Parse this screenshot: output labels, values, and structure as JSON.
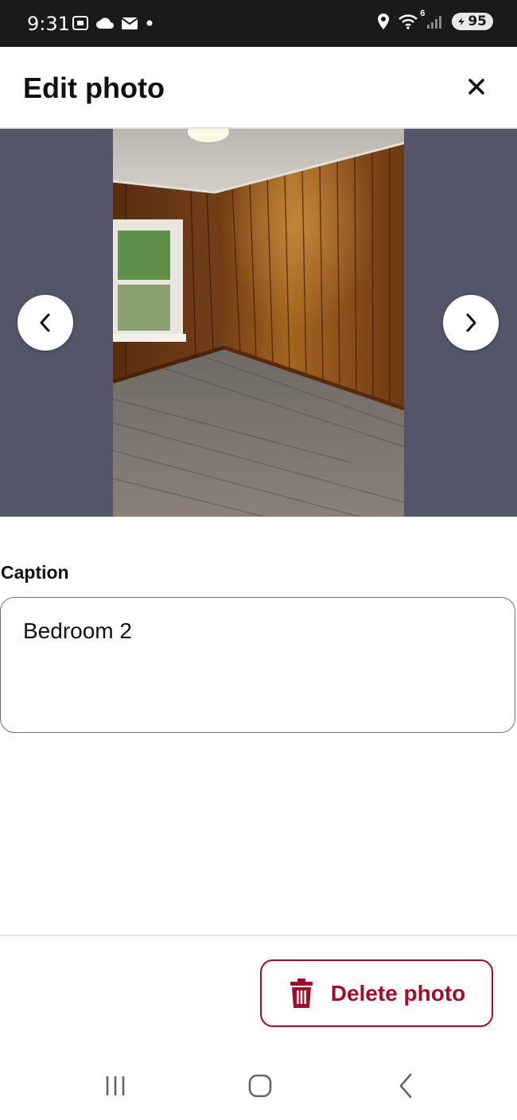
{
  "status_bar": {
    "time": "9:31",
    "battery": "95",
    "signal_label": "6",
    "icons": [
      "screenshot-icon",
      "cloud-icon",
      "mail-icon",
      "dot-icon",
      "location-icon",
      "wifi-icon",
      "signal-icon",
      "battery-icon"
    ]
  },
  "header": {
    "title": "Edit photo",
    "close_icon": "close-icon"
  },
  "photo": {
    "prev_icon": "chevron-left-icon",
    "next_icon": "chevron-right-icon",
    "background_color": "#55556a"
  },
  "caption": {
    "label": "Caption",
    "value": "Bedroom 2"
  },
  "footer": {
    "delete_label": "Delete photo",
    "delete_icon": "trash-icon",
    "accent_color": "#a50c2c"
  },
  "system_nav": {
    "icons": [
      "recent-apps-icon",
      "home-icon",
      "back-icon"
    ]
  }
}
